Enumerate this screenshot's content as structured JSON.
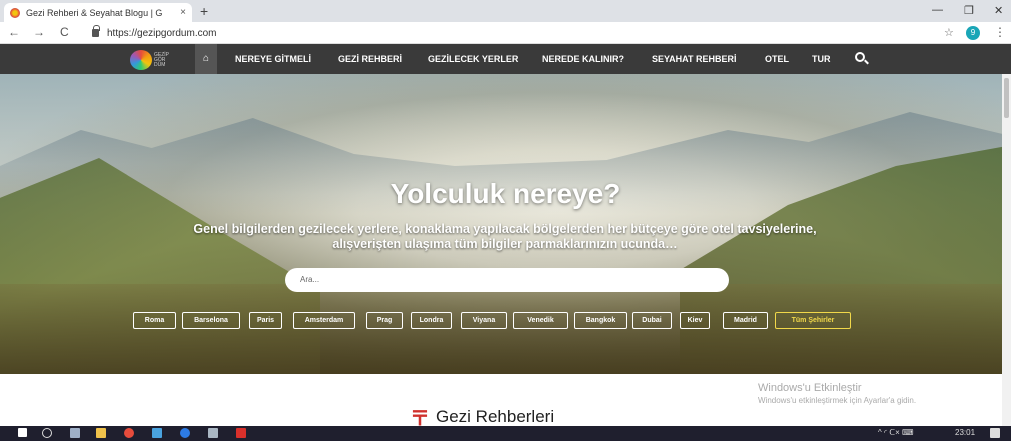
{
  "browser": {
    "tab_title": "Gezi Rehberi & Seyahat Blogu | G",
    "tab_close": "×",
    "new_tab": "+",
    "url": "https://gezipgordum.com",
    "back": "←",
    "forward": "→",
    "reload": "C",
    "star": "☆",
    "profile_initial": "9",
    "menu": "⋮",
    "minimize": "—",
    "maximize": "❐",
    "close": "✕"
  },
  "site": {
    "logo_text_1": "GEZİP",
    "logo_text_2": "GÖR",
    "logo_text_3": "DÜM",
    "home_icon": "⌂",
    "nav": [
      "NEREYE GİTMELİ",
      "GEZİ REHBERİ",
      "GEZİLECEK YERLER",
      "NEREDE KALINIR?",
      "SEYAHAT REHBERİ",
      "OTEL",
      "TUR"
    ]
  },
  "hero": {
    "title": "Yolculuk nereye?",
    "subtitle": "Genel bilgilerden gezilecek yerlere, konaklama yapılacak bölgelerden her bütçeye göre otel tavsiyelerine, alışverişten ulaşıma tüm bilgiler parmaklarınızın ucunda…",
    "search_placeholder": "Ara...",
    "cities": [
      "Roma",
      "Barselona",
      "Paris",
      "Amsterdam",
      "Prag",
      "Londra",
      "Viyana",
      "Venedik",
      "Bangkok",
      "Dubai",
      "Kiev",
      "Madrid"
    ],
    "all_cities": "Tüm Şehirler"
  },
  "below": {
    "section_symbol": "〒",
    "section_title": "Gezi Rehberleri",
    "activation_title": "Windows'u Etkinleştir",
    "activation_sub": "Windows'u etkinleştirmek için Ayarlar'a gidin."
  },
  "taskbar": {
    "time": "23:01",
    "tray_icons": "^ ◜ ᑕ× ⌨"
  }
}
